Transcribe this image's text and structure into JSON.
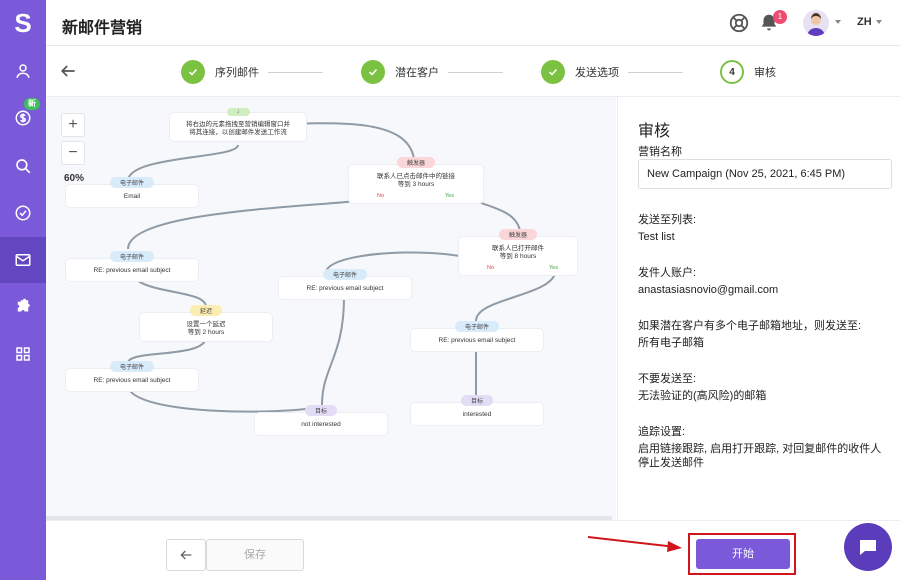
{
  "app": {
    "logo": "S",
    "title": "新邮件营销",
    "new_badge": "新",
    "lang": "ZH",
    "notifications": "1"
  },
  "steps": [
    {
      "label": "序列邮件",
      "state": "done"
    },
    {
      "label": "潜在客户",
      "state": "done"
    },
    {
      "label": "发送选项",
      "state": "done"
    },
    {
      "label": "审核",
      "number": "4",
      "state": "current"
    }
  ],
  "canvas": {
    "zoom_in": "+",
    "zoom_out": "−",
    "zoom_level": "60%",
    "start_node": {
      "line1": "将右边的元素拖拽至营销编辑窗口并",
      "line2": "将其连接，以创建邮件发送工作流"
    },
    "nodes": {
      "email1": {
        "tag": "电子邮件",
        "text": "Email"
      },
      "trigger1": {
        "tag": "触发器",
        "line1": "联系人已点击邮件中的链接",
        "line2": "等到 3 hours",
        "no": "No",
        "yes": "Yes"
      },
      "email2": {
        "tag": "电子邮件",
        "text": "RE: previous email subject"
      },
      "trigger2": {
        "tag": "触发器",
        "line1": "联系人已打开邮件",
        "line2": "等到 8 hours",
        "no": "No",
        "yes": "Yes"
      },
      "email3": {
        "tag": "电子邮件",
        "text": "RE: previous email subject"
      },
      "delay": {
        "tag": "延迟",
        "line1": "设置一个延迟",
        "line2": "等到 2 hours"
      },
      "email4": {
        "tag": "电子邮件",
        "text": "RE: previous email subject"
      },
      "email5": {
        "tag": "电子邮件",
        "text": "RE: previous email subject"
      },
      "goal1": {
        "tag": "目标",
        "text": "not interested"
      },
      "goal2": {
        "tag": "目标",
        "text": "interested"
      }
    }
  },
  "review": {
    "title": "审核",
    "name_label": "营销名称",
    "name_value": "New Campaign (Nov 25, 2021, 6:45 PM)",
    "list_label": "发送至列表:",
    "list_value": "Test list",
    "sender_label": "发件人账户:",
    "sender_value": "anastasiasnovio@gmail.com",
    "multi_label": "如果潜在客户有多个电子邮箱地址，则发送至:",
    "multi_value": "所有电子邮箱",
    "dont_send_label": "不要发送至:",
    "dont_send_value": "无法验证的(高风险)的邮箱",
    "tracking_label": "追踪设置:",
    "tracking_value": "启用链接跟踪, 启用打开跟踪, 对回复邮件的收件人停止发送邮件"
  },
  "footer": {
    "save_label": "保存",
    "start_label": "开始"
  },
  "colors": {
    "brand": "#7a5ad8",
    "success": "#7cc242",
    "highlight": "#d0161c"
  }
}
